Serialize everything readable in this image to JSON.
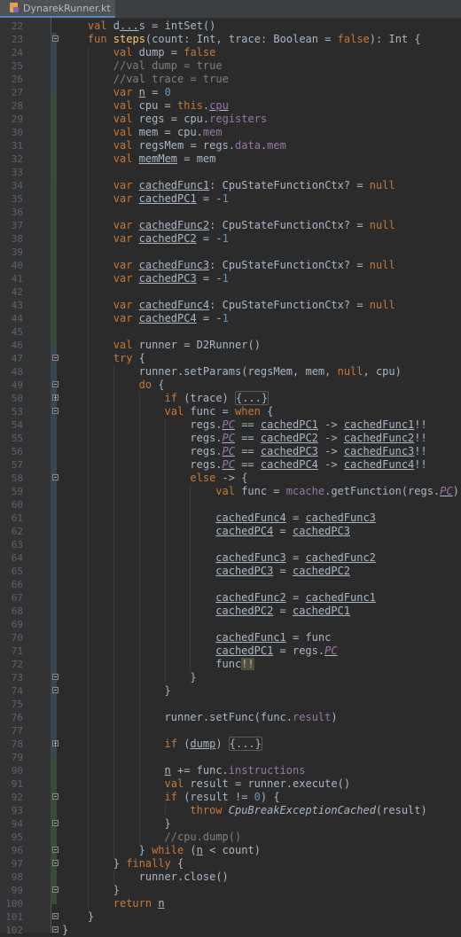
{
  "tab": {
    "file_name": "DynarekRunner.kt",
    "close_icon": "×"
  },
  "editor": {
    "lines": [
      {
        "n": "22",
        "indent": 1,
        "html": "<span class=\"kw\">val</span> d<span class=\"ul\">...</span>s = intSet()"
      },
      {
        "n": "23",
        "indent": 1,
        "html": "<span class=\"kw\">fun</span> <span class=\"fn\">steps</span>(count: Int, trace: Boolean = <span class=\"kw\">false</span>): Int {",
        "fold": "minus"
      },
      {
        "n": "24",
        "indent": 2,
        "html": "<span class=\"kw\">val</span> dump = <span class=\"kw\">false</span>"
      },
      {
        "n": "25",
        "indent": 2,
        "html": "<span class=\"cm\">//val dump = true</span>"
      },
      {
        "n": "26",
        "indent": 2,
        "html": "<span class=\"cm\">//val trace = true</span>"
      },
      {
        "n": "27",
        "indent": 2,
        "html": "<span class=\"kw\">var</span> <span class=\"ul\">n</span> = <span class=\"nm\">0</span>"
      },
      {
        "n": "28",
        "indent": 2,
        "html": "<span class=\"kw\">val</span> cpu = <span class=\"kw\">this</span>.<span class=\"prop ul\">cpu</span>"
      },
      {
        "n": "29",
        "indent": 2,
        "html": "<span class=\"kw\">val</span> regs = cpu.<span class=\"prop\">registers</span>"
      },
      {
        "n": "30",
        "indent": 2,
        "html": "<span class=\"kw\">val</span> mem = cpu.<span class=\"prop\">mem</span>"
      },
      {
        "n": "31",
        "indent": 2,
        "html": "<span class=\"kw\">val</span> regsMem = regs.<span class=\"prop\">data</span>.<span class=\"prop\">mem</span>"
      },
      {
        "n": "32",
        "indent": 2,
        "html": "<span class=\"kw\">val</span> <span class=\"ul\">memMem</span> = mem"
      },
      {
        "n": "33",
        "indent": 2,
        "html": ""
      },
      {
        "n": "34",
        "indent": 2,
        "html": "<span class=\"kw\">var</span> <span class=\"ul\">cachedFunc1</span>: CpuStateFunctionCtx? = <span class=\"kw\">null</span>"
      },
      {
        "n": "35",
        "indent": 2,
        "html": "<span class=\"kw\">var</span> <span class=\"ul\">cachedPC1</span> = -<span class=\"nm\">1</span>"
      },
      {
        "n": "36",
        "indent": 2,
        "html": ""
      },
      {
        "n": "37",
        "indent": 2,
        "html": "<span class=\"kw\">var</span> <span class=\"ul\">cachedFunc2</span>: CpuStateFunctionCtx? = <span class=\"kw\">null</span>"
      },
      {
        "n": "38",
        "indent": 2,
        "html": "<span class=\"kw\">var</span> <span class=\"ul\">cachedPC2</span> = -<span class=\"nm\">1</span>"
      },
      {
        "n": "39",
        "indent": 2,
        "html": ""
      },
      {
        "n": "40",
        "indent": 2,
        "html": "<span class=\"kw\">var</span> <span class=\"ul\">cachedFunc3</span>: CpuStateFunctionCtx? = <span class=\"kw\">null</span>"
      },
      {
        "n": "41",
        "indent": 2,
        "html": "<span class=\"kw\">var</span> <span class=\"ul\">cachedPC3</span> = -<span class=\"nm\">1</span>"
      },
      {
        "n": "42",
        "indent": 2,
        "html": ""
      },
      {
        "n": "43",
        "indent": 2,
        "html": "<span class=\"kw\">var</span> <span class=\"ul\">cachedFunc4</span>: CpuStateFunctionCtx? = <span class=\"kw\">null</span>"
      },
      {
        "n": "44",
        "indent": 2,
        "html": "<span class=\"kw\">var</span> <span class=\"ul\">cachedPC4</span> = -<span class=\"nm\">1</span>"
      },
      {
        "n": "45",
        "indent": 2,
        "html": ""
      },
      {
        "n": "46",
        "indent": 2,
        "html": "<span class=\"kw\">val</span> runner = D2Runner()"
      },
      {
        "n": "47",
        "indent": 2,
        "html": "<span class=\"kw\">try</span> {",
        "fold": "minus"
      },
      {
        "n": "48",
        "indent": 3,
        "html": "runner.setParams(regsMem, mem, <span class=\"kw\">null</span>, cpu)"
      },
      {
        "n": "49",
        "indent": 3,
        "html": "<span class=\"kw\">do</span> {",
        "fold": "minus"
      },
      {
        "n": "50",
        "indent": 4,
        "html": "<span class=\"kw\">if</span> (trace) <span class=\"folded\">{...}</span>",
        "fold": "plus"
      },
      {
        "n": "53",
        "indent": 4,
        "html": "<span class=\"kw\">val</span> func = <span class=\"kw\">when</span> {",
        "fold": "minus"
      },
      {
        "n": "54",
        "indent": 5,
        "html": "regs.<span class=\"prop ul it\">PC</span> == <span class=\"ul\">cachedPC1</span> -&gt; <span class=\"ul\">cachedFunc1</span>!!"
      },
      {
        "n": "55",
        "indent": 5,
        "html": "regs.<span class=\"prop ul it\">PC</span> == <span class=\"ul\">cachedPC2</span> -&gt; <span class=\"ul\">cachedFunc2</span>!!"
      },
      {
        "n": "56",
        "indent": 5,
        "html": "regs.<span class=\"prop ul it\">PC</span> == <span class=\"ul\">cachedPC3</span> -&gt; <span class=\"ul\">cachedFunc3</span>!!"
      },
      {
        "n": "57",
        "indent": 5,
        "html": "regs.<span class=\"prop ul it\">PC</span> == <span class=\"ul\">cachedPC4</span> -&gt; <span class=\"ul\">cachedFunc4</span>!!"
      },
      {
        "n": "58",
        "indent": 5,
        "html": "<span class=\"kw\">else</span> -&gt; {",
        "fold": "minus"
      },
      {
        "n": "59",
        "indent": 6,
        "html": "<span class=\"kw\">val</span> func = <span class=\"prop\">mcache</span>.getFunction(regs.<span class=\"prop ul it\">PC</span>)"
      },
      {
        "n": "60",
        "indent": 6,
        "html": ""
      },
      {
        "n": "61",
        "indent": 6,
        "html": "<span class=\"ul\">cachedFunc4</span> = <span class=\"ul\">cachedFunc3</span>"
      },
      {
        "n": "62",
        "indent": 6,
        "html": "<span class=\"ul\">cachedPC4</span> = <span class=\"ul\">cachedPC3</span>"
      },
      {
        "n": "63",
        "indent": 6,
        "html": ""
      },
      {
        "n": "64",
        "indent": 6,
        "html": "<span class=\"ul\">cachedFunc3</span> = <span class=\"ul\">cachedFunc2</span>"
      },
      {
        "n": "65",
        "indent": 6,
        "html": "<span class=\"ul\">cachedPC3</span> = <span class=\"ul\">cachedPC2</span>"
      },
      {
        "n": "66",
        "indent": 6,
        "html": ""
      },
      {
        "n": "67",
        "indent": 6,
        "html": "<span class=\"ul\">cachedFunc2</span> = <span class=\"ul\">cachedFunc1</span>"
      },
      {
        "n": "68",
        "indent": 6,
        "html": "<span class=\"ul\">cachedPC2</span> = <span class=\"ul\">cachedPC1</span>"
      },
      {
        "n": "69",
        "indent": 6,
        "html": ""
      },
      {
        "n": "70",
        "indent": 6,
        "html": "<span class=\"ul\">cachedFunc1</span> = func"
      },
      {
        "n": "71",
        "indent": 6,
        "html": "<span class=\"ul\">cachedPC1</span> = regs.<span class=\"prop ul it\">PC</span>"
      },
      {
        "n": "72",
        "indent": 6,
        "html": "func<span class=\"warn\">!!</span>"
      },
      {
        "n": "73",
        "indent": 5,
        "html": "}",
        "fold": "minus"
      },
      {
        "n": "74",
        "indent": 4,
        "html": "}",
        "fold": "minus"
      },
      {
        "n": "75",
        "indent": 4,
        "html": ""
      },
      {
        "n": "76",
        "indent": 4,
        "html": "runner.setFunc(func.<span class=\"prop\">result</span>)"
      },
      {
        "n": "77",
        "indent": 4,
        "html": ""
      },
      {
        "n": "78",
        "indent": 4,
        "html": "<span class=\"kw\">if</span> (<span class=\"ul\">dump</span>) <span class=\"folded\">{...}</span>",
        "fold": "plus"
      },
      {
        "n": "79",
        "indent": 4,
        "html": ""
      },
      {
        "n": "90",
        "indent": 4,
        "html": "<span class=\"ul\">n</span> += func.<span class=\"prop\">instructions</span>"
      },
      {
        "n": "91",
        "indent": 4,
        "html": "<span class=\"kw\">val</span> result = runner.execute()"
      },
      {
        "n": "92",
        "indent": 4,
        "html": "<span class=\"kw\">if</span> (result != <span class=\"nm\">0</span>) {",
        "fold": "minus"
      },
      {
        "n": "93",
        "indent": 5,
        "html": "<span class=\"kw\">throw</span> <span class=\"it\">CpuBreakExceptionCached</span>(result)"
      },
      {
        "n": "94",
        "indent": 4,
        "html": "}",
        "fold": "minus"
      },
      {
        "n": "95",
        "indent": 4,
        "html": "<span class=\"cm\">//cpu.dump()</span>"
      },
      {
        "n": "96",
        "indent": 3,
        "html": "} <span class=\"kw\">while</span> (<span class=\"ul\">n</span> &lt; count)",
        "fold": "minus"
      },
      {
        "n": "97",
        "indent": 2,
        "html": "} <span class=\"kw\">finally</span> {",
        "fold": "minus"
      },
      {
        "n": "98",
        "indent": 3,
        "html": "runner.close()"
      },
      {
        "n": "99",
        "indent": 2,
        "html": "}",
        "fold": "minus"
      },
      {
        "n": "100",
        "indent": 2,
        "html": "<span class=\"kw\">return</span> <span class=\"ul\">n</span>"
      },
      {
        "n": "101",
        "indent": 1,
        "html": "}",
        "fold": "minus"
      },
      {
        "n": "102",
        "indent": 0,
        "html": "}",
        "fold": "minus"
      }
    ]
  },
  "colors": {
    "background": "#2b2b2b",
    "gutter": "#313335",
    "keyword": "#cc7832",
    "function": "#ffc66d",
    "number": "#6897bb",
    "comment": "#808080",
    "property": "#9876aa",
    "vcs_added": "#384c38",
    "vcs_modified": "#374752"
  }
}
